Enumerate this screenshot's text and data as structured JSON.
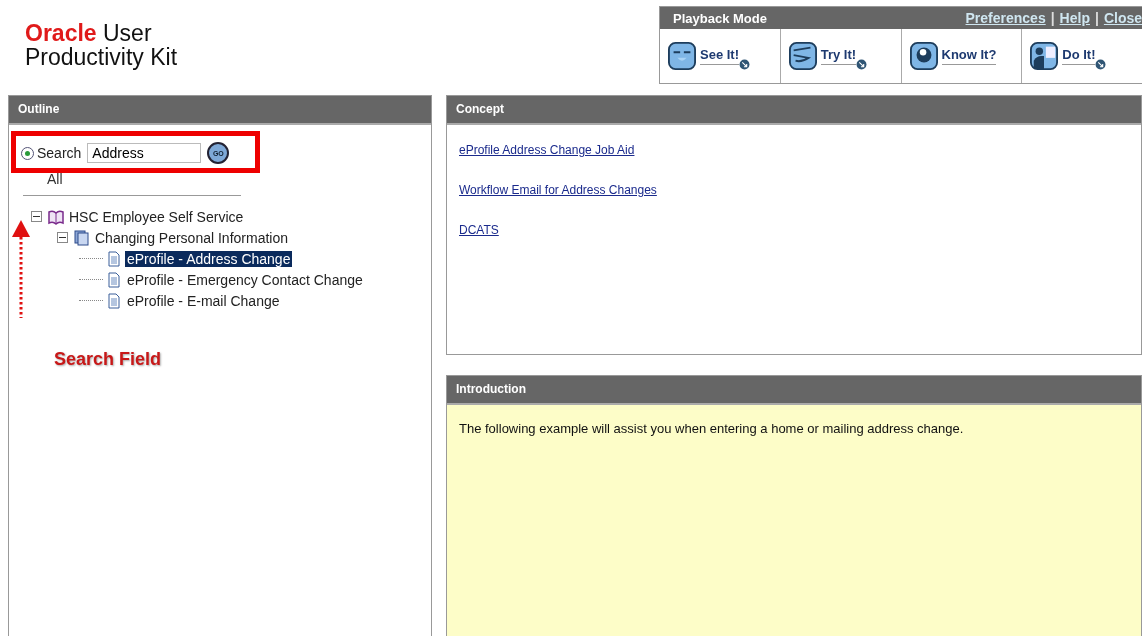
{
  "logo": {
    "brand": "Oracle",
    "line1": "User",
    "line2": "Productivity Kit"
  },
  "playback": {
    "title": "Playback Mode",
    "links": [
      "Preferences",
      "Help",
      "Close"
    ],
    "separator": "|",
    "modes": [
      {
        "label": "See It!",
        "kind": "see",
        "popup": true
      },
      {
        "label": "Try It!",
        "kind": "try",
        "popup": true
      },
      {
        "label": "Know It?",
        "kind": "know",
        "popup": false
      },
      {
        "label": "Do It!",
        "kind": "do",
        "popup": true
      }
    ]
  },
  "outline": {
    "title": "Outline",
    "search_option": {
      "label": "Search",
      "selected": true
    },
    "search_value": "Address",
    "go": "GO",
    "all_label": "All",
    "tree": [
      {
        "label": "HSC Employee Self Service",
        "kind": "book",
        "expanded": true,
        "selected": false,
        "children": [
          {
            "label": "Changing Personal Information",
            "kind": "module",
            "expanded": true,
            "selected": false,
            "children": [
              {
                "label": "eProfile - Address Change",
                "kind": "topic",
                "selected": true
              },
              {
                "label": "eProfile - Emergency Contact Change",
                "kind": "topic",
                "selected": false
              },
              {
                "label": "eProfile - E-mail Change",
                "kind": "topic",
                "selected": false
              }
            ]
          }
        ]
      }
    ]
  },
  "annotation": {
    "label": "Search Field"
  },
  "concept": {
    "title": "Concept",
    "links": [
      "eProfile Address Change Job Aid",
      "Workflow Email for Address Changes",
      "DCATS"
    ]
  },
  "introduction": {
    "title": "Introduction",
    "text": "The following example will assist you when entering a home or mailing address change."
  }
}
